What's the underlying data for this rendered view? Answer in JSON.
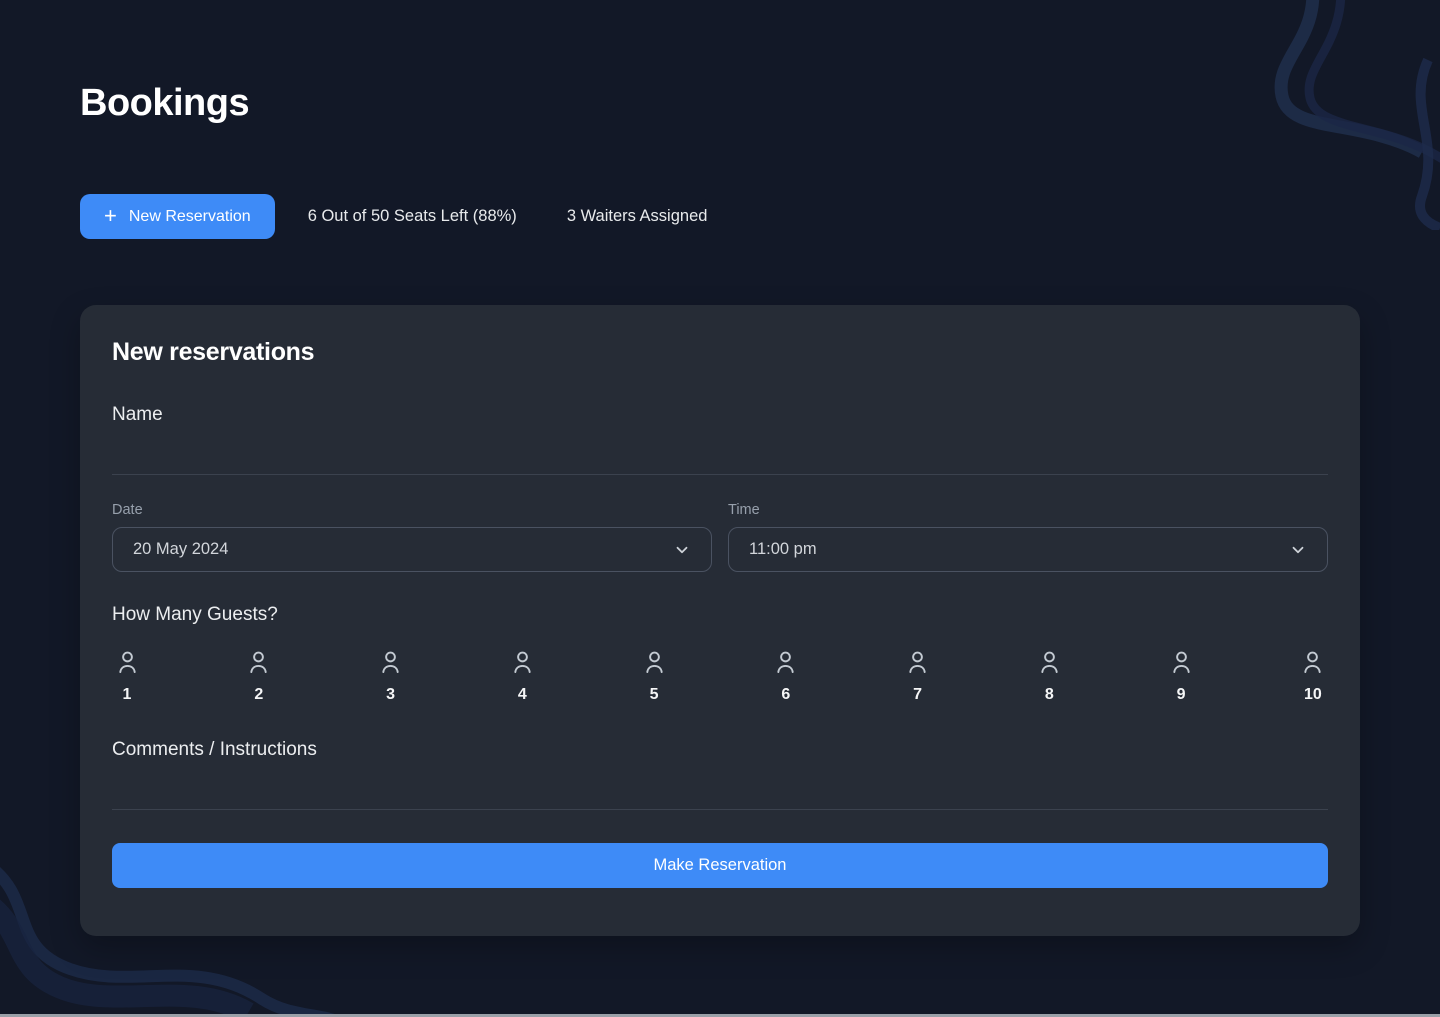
{
  "page": {
    "title": "Bookings"
  },
  "toolbar": {
    "new_reservation": {
      "label": "New Reservation",
      "plus_icon": "+"
    },
    "seats_status": "6 Out of 50 Seats Left (88%)",
    "waiters_status": "3 Waiters Assigned"
  },
  "form": {
    "title": "New reservations",
    "name": {
      "label": "Name",
      "value": ""
    },
    "date": {
      "label": "Date",
      "value": "20 May 2024"
    },
    "time": {
      "label": "Time",
      "value": "11:00 pm"
    },
    "guests": {
      "label": "How Many Guests?",
      "options": [
        "1",
        "2",
        "3",
        "4",
        "5",
        "6",
        "7",
        "8",
        "9",
        "10"
      ]
    },
    "comments": {
      "label": "Comments / Instructions",
      "value": ""
    },
    "submit_label": "Make Reservation"
  },
  "icons": {
    "plus": "plus-icon",
    "chevron_down": "chevron-down-icon",
    "person": "person-icon"
  },
  "colors": {
    "accent": "#3e8bf7",
    "background": "#121827",
    "card": "#262c36"
  }
}
